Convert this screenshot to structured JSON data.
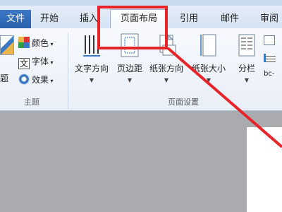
{
  "tabs": {
    "file": "文件",
    "home": "开始",
    "insert": "插入",
    "page_layout": "页面布局",
    "references": "引用",
    "mailings": "邮件",
    "review": "审阅"
  },
  "theme_group": {
    "label": "主题",
    "theme_button": "题",
    "colors": "颜色",
    "fonts": "字体",
    "effects": "效果"
  },
  "page_setup_group": {
    "label": "页面设置",
    "text_direction": "文字方向",
    "margins": "页边距",
    "orientation": "纸张方向",
    "size": "纸张大小",
    "columns": "分栏",
    "hyphenation_partial": "bc-"
  },
  "annotation": {
    "color": "#e8242b"
  }
}
